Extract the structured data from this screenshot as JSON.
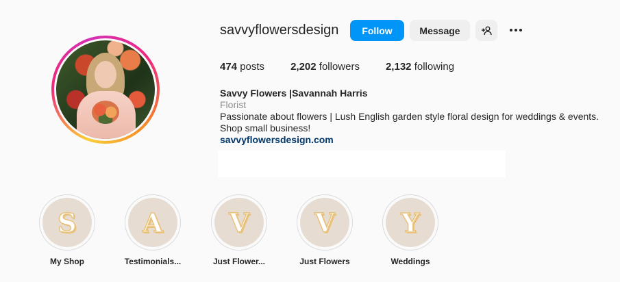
{
  "profile": {
    "username": "savvyflowersdesign",
    "follow_label": "Follow",
    "message_label": "Message",
    "add_user_icon": "add-user-icon",
    "more_icon": "more-options-icon"
  },
  "stats": {
    "posts_count": "474",
    "posts_label": "posts",
    "followers_count": "2,202",
    "followers_label": "followers",
    "following_count": "2,132",
    "following_label": "following"
  },
  "bio": {
    "name": "Savvy Flowers |Savannah Harris",
    "category": "Florist",
    "description_line1": "Passionate about flowers | Lush English garden style floral design for weddings & events.",
    "description_line2": "Shop small business!",
    "link": "savvyflowersdesign.com"
  },
  "highlights": [
    {
      "letter": "S",
      "label": "My Shop"
    },
    {
      "letter": "A",
      "label": "Testimonials..."
    },
    {
      "letter": "V",
      "label": "Just Flower..."
    },
    {
      "letter": "V",
      "label": "Just Flowers"
    },
    {
      "letter": "Y",
      "label": "Weddings"
    }
  ],
  "colors": {
    "accent": "#0095f6",
    "link": "#00376b",
    "highlight_bg": "#e6dcd2",
    "letter_outline": "#e8c27a"
  }
}
